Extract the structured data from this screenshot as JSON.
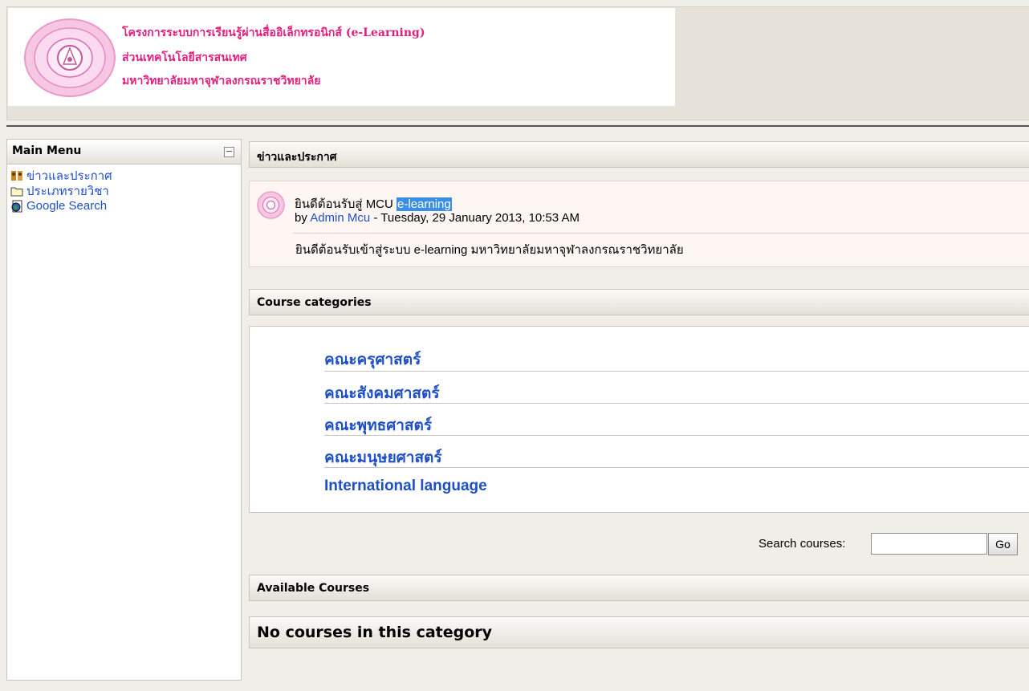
{
  "banner": {
    "line1": "โครงการระบบการเรียนรู้ผ่านสื่ออิเล็กทรอนิกส์ (e-Learning)",
    "line2": "ส่วนเทคโนโลยีสารสนเทศ",
    "line3": "มหาวิทยาลัยมหาจุฬาลงกรณราชวิทยาลัย"
  },
  "sidebar": {
    "title": "Main Menu",
    "collapse_symbol": "−",
    "items": [
      {
        "label": "ข่าวและประกาศ",
        "icon": "forum-icon"
      },
      {
        "label": "ประเภทรายวิชา",
        "icon": "folder-icon"
      },
      {
        "label": "Google Search",
        "icon": "globe-page-icon"
      }
    ]
  },
  "news": {
    "heading": "ข่าวและประกาศ",
    "post": {
      "subject_prefix": "ยินดีต้อนรับสู่ MCU ",
      "subject_highlight": "e-learning",
      "by_label": "by ",
      "author": "Admin Mcu",
      "date": " - Tuesday, 29 January 2013, 10:53 AM",
      "body": "ยินดีต้อนรับเข้าสู่ระบบ e-learning มหาวิทยาลัยมหาจุฬาลงกรณราชวิทยาลัย"
    }
  },
  "categories": {
    "heading": "Course categories",
    "items": [
      "คณะครุศาสตร์",
      "คณะสังคมศาสตร์",
      "คณะพุทธศาสตร์",
      "คณะมนุษยศาสตร์",
      "International language"
    ]
  },
  "search": {
    "label": "Search courses:",
    "value": "",
    "button": "Go"
  },
  "available": {
    "heading": "Available Courses",
    "empty_message": "No courses in this category"
  },
  "colors": {
    "link": "#1f4fc6",
    "banner_text": "#e0207e",
    "highlight": "#3a8ee6"
  }
}
